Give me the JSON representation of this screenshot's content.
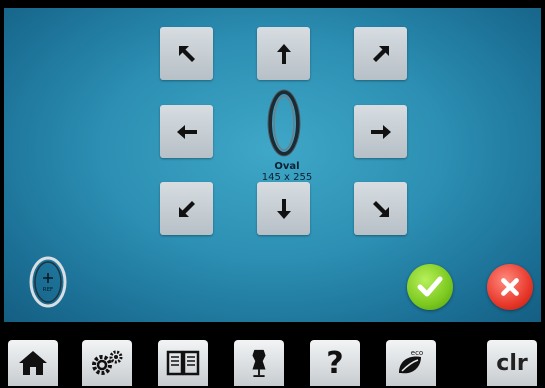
{
  "hoop": {
    "name": "Oval",
    "size": "145 x 255"
  },
  "reference_hoop": {
    "label": "REF"
  },
  "toolbar": {
    "help_label": "?",
    "eco_label": "eco",
    "clr_label": "clr"
  },
  "colors": {
    "screen_bg": "#2c8fb3",
    "button_bg": "#c7ced4",
    "confirm": "#7cc91f",
    "cancel": "#e8392b"
  }
}
